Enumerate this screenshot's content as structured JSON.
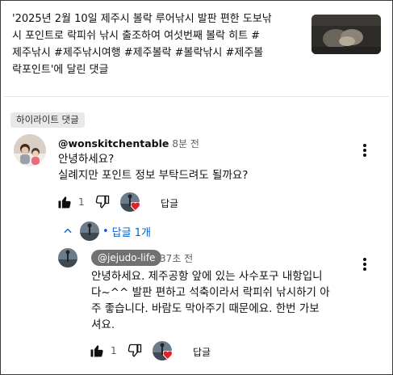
{
  "video": {
    "title_line1": "'2025년 2월 10일 제주시 볼락 루어낚시 발판 편한 도보낚",
    "title_line2": "시 포인트로 락피쉬 낚시 출조하여 여섯번째 볼락 히트 #",
    "title_line3": "제주낚시 #제주낚시여행 #제주볼락 #볼락낚시 #제주볼",
    "title_line4": "락포인트'에 달린 댓글",
    "thumbnail_icon": "fishing-video-thumbnail"
  },
  "highlight_label": "하이라이트 댓글",
  "comment": {
    "author": "@wonskitchentable",
    "time": "8분 전",
    "text_line1": "안녕하세요?",
    "text_line2": "실례지만 포인트 정보 부탁드려도 될까요?",
    "likes": "1",
    "reply_label": "답글"
  },
  "replies_toggle_label": "답글 1개",
  "reply": {
    "author": "@jejudo-life",
    "time": "37초 전",
    "text_line1": "안녕하세요. 제주공항 앞에 있는 사수포구 내항입니",
    "text_line2": "다~^^ 발판 편하고 석축이라서 락피쉬 낚시하기 아",
    "text_line3": "주 좋습니다. 바람도 막아주기 때문에요. 한번 가보",
    "text_line4": "셔요.",
    "likes": "1",
    "reply_label": "답글"
  },
  "colors": {
    "link_blue": "#065fd4",
    "heart_red": "#e0222b",
    "chip_gray": "#717171"
  }
}
